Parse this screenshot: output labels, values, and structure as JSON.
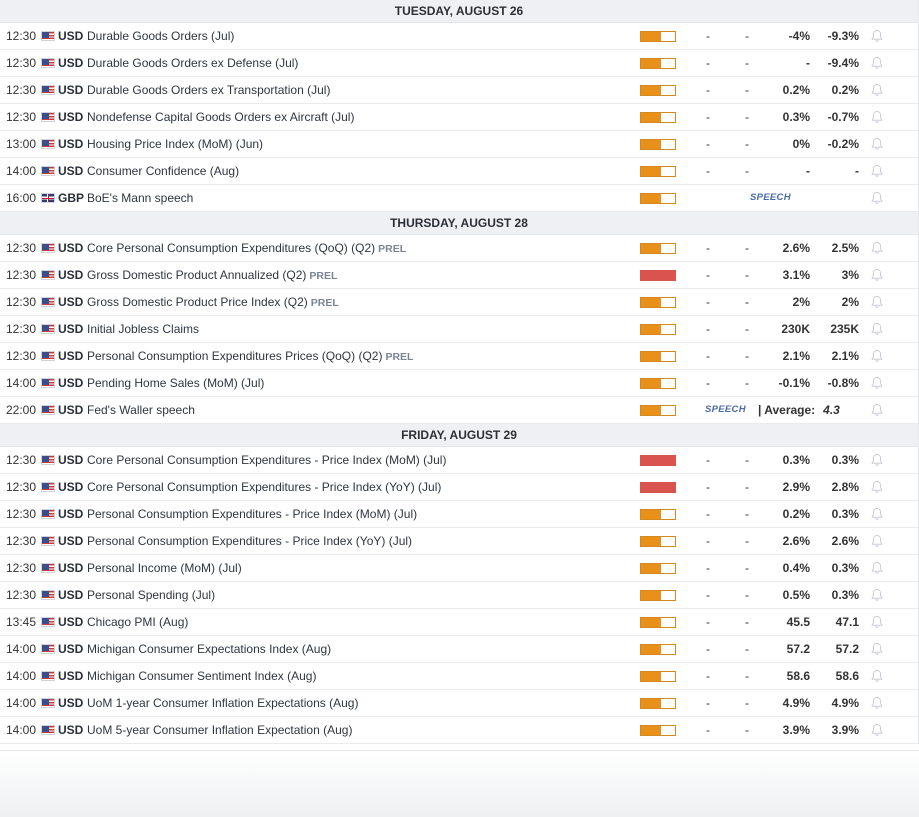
{
  "colors": {
    "medium_impact": "#e8901a",
    "high_impact": "#d9534f",
    "header_bg": "#eef0f3"
  },
  "days": [
    {
      "label": "TUESDAY, AUGUST 26",
      "events": [
        {
          "time": "12:30",
          "flag": "us",
          "currency": "USD",
          "name": "Durable Goods Orders (Jul)",
          "tag": "",
          "impact": "medium",
          "actual": "-",
          "deviation": "-",
          "consensus": "-4%",
          "previous": "-9.3%"
        },
        {
          "time": "12:30",
          "flag": "us",
          "currency": "USD",
          "name": "Durable Goods Orders ex Defense (Jul)",
          "tag": "",
          "impact": "medium",
          "actual": "-",
          "deviation": "-",
          "consensus": "-",
          "previous": "-9.4%"
        },
        {
          "time": "12:30",
          "flag": "us",
          "currency": "USD",
          "name": "Durable Goods Orders ex Transportation (Jul)",
          "tag": "",
          "impact": "medium",
          "actual": "-",
          "deviation": "-",
          "consensus": "0.2%",
          "previous": "0.2%"
        },
        {
          "time": "12:30",
          "flag": "us",
          "currency": "USD",
          "name": "Nondefense Capital Goods Orders ex Aircraft (Jul)",
          "tag": "",
          "impact": "medium",
          "actual": "-",
          "deviation": "-",
          "consensus": "0.3%",
          "previous": "-0.7%"
        },
        {
          "time": "13:00",
          "flag": "us",
          "currency": "USD",
          "name": "Housing Price Index (MoM) (Jun)",
          "tag": "",
          "impact": "medium",
          "actual": "-",
          "deviation": "-",
          "consensus": "0%",
          "previous": "-0.2%"
        },
        {
          "time": "14:00",
          "flag": "us",
          "currency": "USD",
          "name": "Consumer Confidence (Aug)",
          "tag": "",
          "impact": "medium",
          "actual": "-",
          "deviation": "-",
          "consensus": "-",
          "previous": "-"
        },
        {
          "time": "16:00",
          "flag": "gb",
          "currency": "GBP",
          "name": "BoE's Mann speech",
          "tag": "",
          "impact": "medium",
          "speech": "SPEECH",
          "speech_style": "speech1"
        }
      ]
    },
    {
      "label": "THURSDAY, AUGUST 28",
      "events": [
        {
          "time": "12:30",
          "flag": "us",
          "currency": "USD",
          "name": "Core Personal Consumption Expenditures (QoQ) (Q2)",
          "tag": "PREL",
          "impact": "medium",
          "actual": "-",
          "deviation": "-",
          "consensus": "2.6%",
          "previous": "2.5%"
        },
        {
          "time": "12:30",
          "flag": "us",
          "currency": "USD",
          "name": "Gross Domestic Product Annualized (Q2)",
          "tag": "PREL",
          "impact": "high",
          "actual": "-",
          "deviation": "-",
          "consensus": "3.1%",
          "previous": "3%"
        },
        {
          "time": "12:30",
          "flag": "us",
          "currency": "USD",
          "name": "Gross Domestic Product Price Index (Q2)",
          "tag": "PREL",
          "impact": "medium",
          "actual": "-",
          "deviation": "-",
          "consensus": "2%",
          "previous": "2%"
        },
        {
          "time": "12:30",
          "flag": "us",
          "currency": "USD",
          "name": "Initial Jobless Claims",
          "tag": "",
          "impact": "medium",
          "actual": "-",
          "deviation": "-",
          "consensus": "230K",
          "previous": "235K"
        },
        {
          "time": "12:30",
          "flag": "us",
          "currency": "USD",
          "name": "Personal Consumption Expenditures Prices (QoQ) (Q2)",
          "tag": "PREL",
          "impact": "medium",
          "actual": "-",
          "deviation": "-",
          "consensus": "2.1%",
          "previous": "2.1%"
        },
        {
          "time": "14:00",
          "flag": "us",
          "currency": "USD",
          "name": "Pending Home Sales (MoM) (Jul)",
          "tag": "",
          "impact": "medium",
          "actual": "-",
          "deviation": "-",
          "consensus": "-0.1%",
          "previous": "-0.8%"
        },
        {
          "time": "22:00",
          "flag": "us",
          "currency": "USD",
          "name": "Fed's Waller speech",
          "tag": "",
          "impact": "medium",
          "speech": "SPEECH",
          "speech_style": "speech2",
          "average_label": "| Average:",
          "average_value": "4.3"
        }
      ]
    },
    {
      "label": "FRIDAY, AUGUST 29",
      "events": [
        {
          "time": "12:30",
          "flag": "us",
          "currency": "USD",
          "name": "Core Personal Consumption Expenditures - Price Index (MoM) (Jul)",
          "tag": "",
          "impact": "high",
          "actual": "-",
          "deviation": "-",
          "consensus": "0.3%",
          "previous": "0.3%"
        },
        {
          "time": "12:30",
          "flag": "us",
          "currency": "USD",
          "name": "Core Personal Consumption Expenditures - Price Index (YoY) (Jul)",
          "tag": "",
          "impact": "high",
          "actual": "-",
          "deviation": "-",
          "consensus": "2.9%",
          "previous": "2.8%"
        },
        {
          "time": "12:30",
          "flag": "us",
          "currency": "USD",
          "name": "Personal Consumption Expenditures - Price Index (MoM) (Jul)",
          "tag": "",
          "impact": "medium",
          "actual": "-",
          "deviation": "-",
          "consensus": "0.2%",
          "previous": "0.3%"
        },
        {
          "time": "12:30",
          "flag": "us",
          "currency": "USD",
          "name": "Personal Consumption Expenditures - Price Index (YoY) (Jul)",
          "tag": "",
          "impact": "medium",
          "actual": "-",
          "deviation": "-",
          "consensus": "2.6%",
          "previous": "2.6%"
        },
        {
          "time": "12:30",
          "flag": "us",
          "currency": "USD",
          "name": "Personal Income (MoM) (Jul)",
          "tag": "",
          "impact": "medium",
          "actual": "-",
          "deviation": "-",
          "consensus": "0.4%",
          "previous": "0.3%"
        },
        {
          "time": "12:30",
          "flag": "us",
          "currency": "USD",
          "name": "Personal Spending (Jul)",
          "tag": "",
          "impact": "medium",
          "actual": "-",
          "deviation": "-",
          "consensus": "0.5%",
          "previous": "0.3%"
        },
        {
          "time": "13:45",
          "flag": "us",
          "currency": "USD",
          "name": "Chicago PMI (Aug)",
          "tag": "",
          "impact": "medium",
          "actual": "-",
          "deviation": "-",
          "consensus": "45.5",
          "previous": "47.1"
        },
        {
          "time": "14:00",
          "flag": "us",
          "currency": "USD",
          "name": "Michigan Consumer Expectations Index (Aug)",
          "tag": "",
          "impact": "medium",
          "actual": "-",
          "deviation": "-",
          "consensus": "57.2",
          "previous": "57.2"
        },
        {
          "time": "14:00",
          "flag": "us",
          "currency": "USD",
          "name": "Michigan Consumer Sentiment Index (Aug)",
          "tag": "",
          "impact": "medium",
          "actual": "-",
          "deviation": "-",
          "consensus": "58.6",
          "previous": "58.6"
        },
        {
          "time": "14:00",
          "flag": "us",
          "currency": "USD",
          "name": "UoM 1-year Consumer Inflation Expectations (Aug)",
          "tag": "",
          "impact": "medium",
          "actual": "-",
          "deviation": "-",
          "consensus": "4.9%",
          "previous": "4.9%"
        },
        {
          "time": "14:00",
          "flag": "us",
          "currency": "USD",
          "name": "UoM 5-year Consumer Inflation Expectation (Aug)",
          "tag": "",
          "impact": "medium",
          "actual": "-",
          "deviation": "-",
          "consensus": "3.9%",
          "previous": "3.9%"
        }
      ]
    }
  ]
}
